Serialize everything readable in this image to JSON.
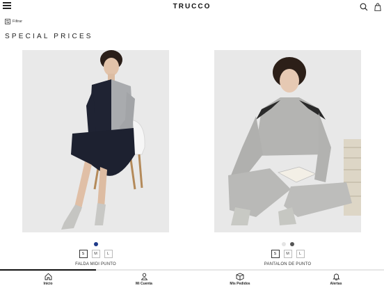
{
  "header": {
    "brand": "TRUCCO",
    "menu_icon": "hamburger-icon",
    "search_icon": "search-icon",
    "bag_icon": "shopping-bag-icon"
  },
  "filter": {
    "label": "Filtrar",
    "icon": "filter-icon"
  },
  "page": {
    "title": "SPECIAL PRICES"
  },
  "products": [
    {
      "name": "FALDA MIDI PUNTO",
      "colors": [
        "#1f3a8a"
      ],
      "sizes": [
        "S",
        "M",
        "L"
      ],
      "selected_size": "S"
    },
    {
      "name": "PANTALON DE PUNTO",
      "colors": [
        "#e4e4e4",
        "#555555"
      ],
      "sizes": [
        "S",
        "M",
        "L"
      ],
      "selected_size": "S"
    }
  ],
  "scroll_progress": 0.25,
  "tabs": [
    {
      "label": "Inicio",
      "icon": "home-icon"
    },
    {
      "label": "Mi Cuenta",
      "icon": "account-icon"
    },
    {
      "label": "Mis Pedidos",
      "icon": "orders-box-icon"
    },
    {
      "label": "Alertas",
      "icon": "bell-icon"
    }
  ]
}
